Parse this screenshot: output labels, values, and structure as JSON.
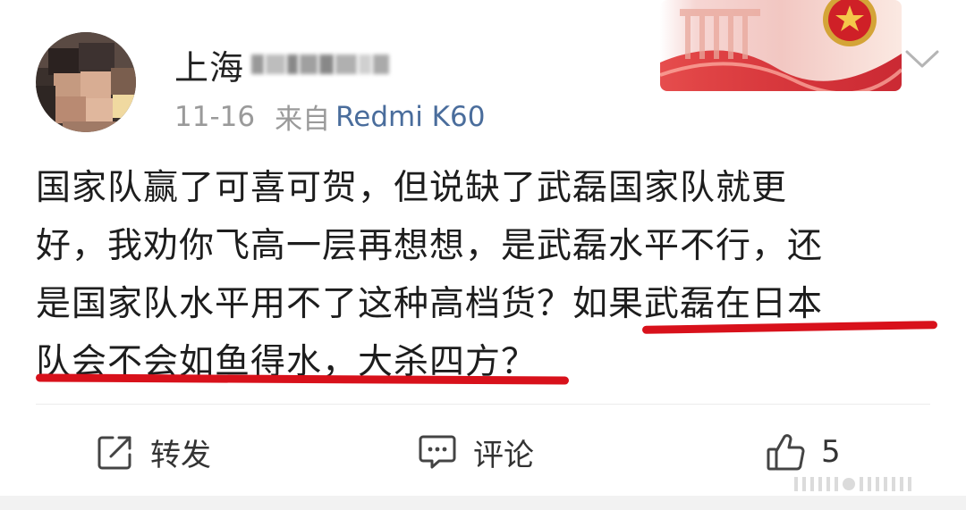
{
  "post": {
    "username": "上海",
    "date": "11-16",
    "source_label": "来自",
    "device": "Redmi K60",
    "text_lines": [
      "国家队赢了可喜可贺，但说缺了武磊国家队就更",
      "好，我劝你飞高一层再想想，是武磊水平不行，还",
      "是国家队水平用不了这种高档货？如果武磊在日本",
      "队会不会如鱼得水，大杀四方？"
    ]
  },
  "actions": {
    "repost_label": "转发",
    "comment_label": "评论",
    "like_count": "5"
  },
  "icons": {
    "avatar": "avatar",
    "banner": "national-emblem-banner",
    "dropdown": "chevron-down-icon",
    "repost": "share-icon",
    "comment": "comment-icon",
    "like": "thumbs-up-icon"
  },
  "colors": {
    "link_blue": "#4a6d9c",
    "highlight_red": "#d8111b",
    "banner_red": "#d31f2b"
  }
}
